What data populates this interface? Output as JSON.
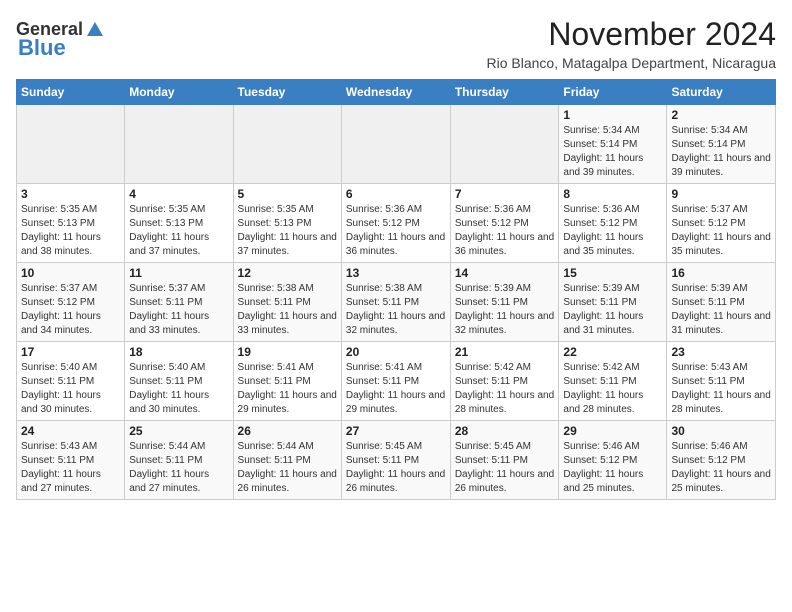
{
  "header": {
    "logo_general": "General",
    "logo_blue": "Blue",
    "month_title": "November 2024",
    "location": "Rio Blanco, Matagalpa Department, Nicaragua"
  },
  "weekdays": [
    "Sunday",
    "Monday",
    "Tuesday",
    "Wednesday",
    "Thursday",
    "Friday",
    "Saturday"
  ],
  "weeks": [
    [
      {
        "day": "",
        "text": ""
      },
      {
        "day": "",
        "text": ""
      },
      {
        "day": "",
        "text": ""
      },
      {
        "day": "",
        "text": ""
      },
      {
        "day": "",
        "text": ""
      },
      {
        "day": "1",
        "text": "Sunrise: 5:34 AM\nSunset: 5:14 PM\nDaylight: 11 hours and 39 minutes."
      },
      {
        "day": "2",
        "text": "Sunrise: 5:34 AM\nSunset: 5:14 PM\nDaylight: 11 hours and 39 minutes."
      }
    ],
    [
      {
        "day": "3",
        "text": "Sunrise: 5:35 AM\nSunset: 5:13 PM\nDaylight: 11 hours and 38 minutes."
      },
      {
        "day": "4",
        "text": "Sunrise: 5:35 AM\nSunset: 5:13 PM\nDaylight: 11 hours and 37 minutes."
      },
      {
        "day": "5",
        "text": "Sunrise: 5:35 AM\nSunset: 5:13 PM\nDaylight: 11 hours and 37 minutes."
      },
      {
        "day": "6",
        "text": "Sunrise: 5:36 AM\nSunset: 5:12 PM\nDaylight: 11 hours and 36 minutes."
      },
      {
        "day": "7",
        "text": "Sunrise: 5:36 AM\nSunset: 5:12 PM\nDaylight: 11 hours and 36 minutes."
      },
      {
        "day": "8",
        "text": "Sunrise: 5:36 AM\nSunset: 5:12 PM\nDaylight: 11 hours and 35 minutes."
      },
      {
        "day": "9",
        "text": "Sunrise: 5:37 AM\nSunset: 5:12 PM\nDaylight: 11 hours and 35 minutes."
      }
    ],
    [
      {
        "day": "10",
        "text": "Sunrise: 5:37 AM\nSunset: 5:12 PM\nDaylight: 11 hours and 34 minutes."
      },
      {
        "day": "11",
        "text": "Sunrise: 5:37 AM\nSunset: 5:11 PM\nDaylight: 11 hours and 33 minutes."
      },
      {
        "day": "12",
        "text": "Sunrise: 5:38 AM\nSunset: 5:11 PM\nDaylight: 11 hours and 33 minutes."
      },
      {
        "day": "13",
        "text": "Sunrise: 5:38 AM\nSunset: 5:11 PM\nDaylight: 11 hours and 32 minutes."
      },
      {
        "day": "14",
        "text": "Sunrise: 5:39 AM\nSunset: 5:11 PM\nDaylight: 11 hours and 32 minutes."
      },
      {
        "day": "15",
        "text": "Sunrise: 5:39 AM\nSunset: 5:11 PM\nDaylight: 11 hours and 31 minutes."
      },
      {
        "day": "16",
        "text": "Sunrise: 5:39 AM\nSunset: 5:11 PM\nDaylight: 11 hours and 31 minutes."
      }
    ],
    [
      {
        "day": "17",
        "text": "Sunrise: 5:40 AM\nSunset: 5:11 PM\nDaylight: 11 hours and 30 minutes."
      },
      {
        "day": "18",
        "text": "Sunrise: 5:40 AM\nSunset: 5:11 PM\nDaylight: 11 hours and 30 minutes."
      },
      {
        "day": "19",
        "text": "Sunrise: 5:41 AM\nSunset: 5:11 PM\nDaylight: 11 hours and 29 minutes."
      },
      {
        "day": "20",
        "text": "Sunrise: 5:41 AM\nSunset: 5:11 PM\nDaylight: 11 hours and 29 minutes."
      },
      {
        "day": "21",
        "text": "Sunrise: 5:42 AM\nSunset: 5:11 PM\nDaylight: 11 hours and 28 minutes."
      },
      {
        "day": "22",
        "text": "Sunrise: 5:42 AM\nSunset: 5:11 PM\nDaylight: 11 hours and 28 minutes."
      },
      {
        "day": "23",
        "text": "Sunrise: 5:43 AM\nSunset: 5:11 PM\nDaylight: 11 hours and 28 minutes."
      }
    ],
    [
      {
        "day": "24",
        "text": "Sunrise: 5:43 AM\nSunset: 5:11 PM\nDaylight: 11 hours and 27 minutes."
      },
      {
        "day": "25",
        "text": "Sunrise: 5:44 AM\nSunset: 5:11 PM\nDaylight: 11 hours and 27 minutes."
      },
      {
        "day": "26",
        "text": "Sunrise: 5:44 AM\nSunset: 5:11 PM\nDaylight: 11 hours and 26 minutes."
      },
      {
        "day": "27",
        "text": "Sunrise: 5:45 AM\nSunset: 5:11 PM\nDaylight: 11 hours and 26 minutes."
      },
      {
        "day": "28",
        "text": "Sunrise: 5:45 AM\nSunset: 5:11 PM\nDaylight: 11 hours and 26 minutes."
      },
      {
        "day": "29",
        "text": "Sunrise: 5:46 AM\nSunset: 5:12 PM\nDaylight: 11 hours and 25 minutes."
      },
      {
        "day": "30",
        "text": "Sunrise: 5:46 AM\nSunset: 5:12 PM\nDaylight: 11 hours and 25 minutes."
      }
    ]
  ]
}
